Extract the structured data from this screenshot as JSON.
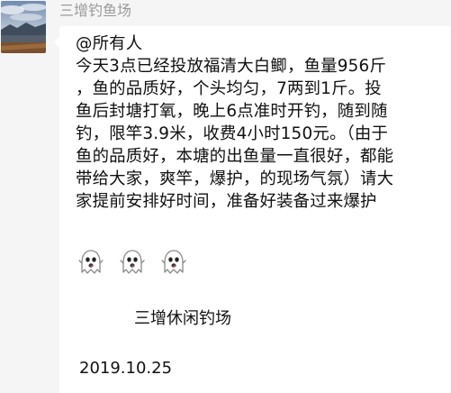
{
  "chat": {
    "sender_name": "三增钓鱼场",
    "avatar_icon": "landscape-avatar-icon",
    "message": {
      "mention": "@所有人",
      "lines": [
        "今天3点已经投放福清大白鲫，鱼量956斤",
        "，鱼的品质好，个头均匀，7两到1斤。投",
        "鱼后封塘打氧，晚上6点准时开钓，随到随",
        "钓，限竿3.9米，收费4小时150元。（由于",
        "鱼的品质好，本塘的出鱼量一直很好，都能",
        "带给大家，爽竿，爆护，的现场气氛）请大",
        "家提前安排好时间，准备好装备过来爆护"
      ],
      "emoji": [
        "ghost-emoji-icon",
        "ghost-emoji-icon",
        "ghost-emoji-icon"
      ],
      "signature": "三增休闲钓场",
      "date": "2019.10.25"
    }
  },
  "colors": {
    "background": "#f5f5f5",
    "bubble": "#ffffff",
    "sender_text": "#9a9a9a",
    "message_text": "#111111"
  }
}
